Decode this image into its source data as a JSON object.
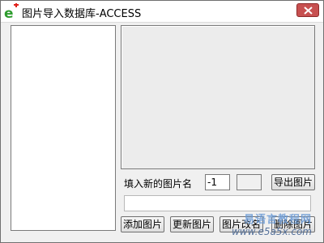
{
  "window": {
    "title": "图片导入数据库-ACCESS",
    "icon": "e-plus-app-icon"
  },
  "form": {
    "name_label": "填入新的图片名",
    "id_value": "-1",
    "empty_value": "",
    "name_input_value": "",
    "buttons": {
      "export": "导出图片",
      "add": "添加图片",
      "update": "更新图片",
      "rename": "图片改名",
      "delete": "删除图片"
    }
  },
  "watermark": {
    "text_cn": "易语言教程网",
    "url": "www.e5a5x.com"
  },
  "colors": {
    "close_button": "#c75050",
    "icon_green": "#2e9c2e",
    "icon_red": "#e0201a"
  }
}
